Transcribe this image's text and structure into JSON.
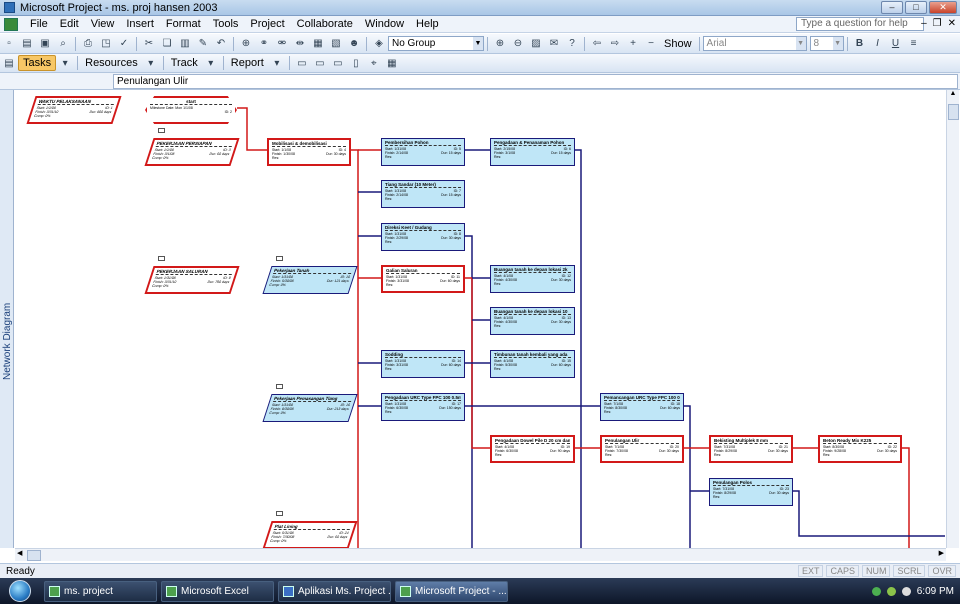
{
  "window": {
    "title": "Microsoft Project - ms. proj hansen 2003"
  },
  "menu": {
    "items": [
      "File",
      "Edit",
      "View",
      "Insert",
      "Format",
      "Tools",
      "Project",
      "Collaborate",
      "Window",
      "Help"
    ],
    "help_placeholder": "Type a question for help"
  },
  "toolbar": {
    "group_value": "No Group",
    "show_label": "Show",
    "font_value": "Arial",
    "size_value": "8"
  },
  "toolbar2": {
    "tasks_label": "Tasks",
    "resources_label": "Resources",
    "track_label": "Track",
    "report_label": "Report"
  },
  "entry": {
    "value": "Penulangan Ulir"
  },
  "viewbar": {
    "label": "Network Diagram"
  },
  "status": {
    "ready": "Ready",
    "indicators": [
      "EXT",
      "CAPS",
      "NUM",
      "SCRL",
      "OVR"
    ]
  },
  "taskbar": {
    "tasks": [
      "ms. project",
      "Microsoft Excel",
      "Aplikasi Ms. Project ...",
      "Microsoft Project - ..."
    ],
    "time": "6:09 PM"
  },
  "nodes": [
    {
      "title": "WAKTU PELAKSANAAN",
      "r1a": "Start: 1/1/08",
      "r1b": "ID: 1",
      "r2a": "Finish: 3/31/10",
      "r2b": "Dur: 800 days",
      "r3": "Comp: 0%"
    },
    {
      "title": "start",
      "r1a": "Milestone Date: Mon 1/1/08",
      "r1b": "",
      "r2a": "",
      "r2b": "ID: 2",
      "r3": ""
    },
    {
      "title": "PEKERJAAN PERSIAPAN",
      "r1a": "Start: 1/1/08",
      "r1b": "ID: 3",
      "r2a": "Finish: 3/1/08",
      "r2b": "Dur: 60 days",
      "r3": "Comp: 0%"
    },
    {
      "title": "Mobilisasi & demobilisasi",
      "r1a": "Start: 1/1/08",
      "r1b": "ID: 4",
      "r2a": "Finish: 1/30/08",
      "r2b": "Dur: 30 days",
      "r3": "Res:"
    },
    {
      "title": "Pembersihan Pohon",
      "r1a": "Start: 1/31/08",
      "r1b": "ID: 5",
      "r2a": "Finish: 2/14/08",
      "r2b": "Dur: 15 days",
      "r3": "Res:"
    },
    {
      "title": "Pengadaan & Penanaman Pohon",
      "r1a": "Start: 2/15/08",
      "r1b": "ID: 6",
      "r2a": "Finish: 3/1/08",
      "r2b": "Dur: 15 days",
      "r3": "Res:"
    },
    {
      "title": "Tiang Sandar (10 Meter)",
      "r1a": "Start: 1/31/08",
      "r1b": "ID: 7",
      "r2a": "Finish: 2/14/08",
      "r2b": "Dur: 15 days",
      "r3": "Res:"
    },
    {
      "title": "Direksi Keet / Gudang",
      "r1a": "Start: 1/31/08",
      "r1b": "ID: 8",
      "r2a": "Finish: 2/29/08",
      "r2b": "Dur: 30 days",
      "r3": "Res:"
    },
    {
      "title": "PEKERJAAN SALURAN",
      "r1a": "Start: 1/31/08",
      "r1b": "ID: 9",
      "r2a": "Finish: 3/31/10",
      "r2b": "Dur: 790 days",
      "r3": "Comp: 0%"
    },
    {
      "title": "Pekerjaan Tanah",
      "r1a": "Start: 1/31/08",
      "r1b": "ID: 10",
      "r2a": "Finish: 5/30/08",
      "r2b": "Dur: 121 days",
      "r3": "Comp: 0%"
    },
    {
      "title": "Galian Saluran",
      "r1a": "Start: 1/31/08",
      "r1b": "ID: 11",
      "r2a": "Finish: 3/31/08",
      "r2b": "Dur: 60 days",
      "r3": "Res:"
    },
    {
      "title": "Buangan tanah ke depan lokasi 2k",
      "r1a": "Start: 4/1/08",
      "r1b": "ID: 12",
      "r2a": "Finish: 4/30/08",
      "r2b": "Dur: 30 days",
      "r3": "Res:"
    },
    {
      "title": "Buangan tanah ke depan lokasi 10",
      "r1a": "Start: 4/1/08",
      "r1b": "ID: 13",
      "r2a": "Finish: 4/30/08",
      "r2b": "Dur: 30 days",
      "r3": "Res:"
    },
    {
      "title": "Sodding",
      "r1a": "Start: 1/31/08",
      "r1b": "ID: 14",
      "r2a": "Finish: 3/31/08",
      "r2b": "Dur: 60 days",
      "r3": "Res:"
    },
    {
      "title": "Timbunan tanah kembali yang ada",
      "r1a": "Start: 4/1/08",
      "r1b": "ID: 15",
      "r2a": "Finish: 5/30/08",
      "r2b": "Dur: 60 days",
      "r3": "Res:"
    },
    {
      "title": "Pekerjaan Pemasangan Tiang",
      "r1a": "Start: 1/31/08",
      "r1b": "ID: 16",
      "r2a": "Finish: 8/30/08",
      "r2b": "Dur: 213 days",
      "r3": "Comp: 0%"
    },
    {
      "title": "Pengadaan URC Type FPC 100 0.5m",
      "r1a": "Start: 1/31/08",
      "r1b": "ID: 17",
      "r2a": "Finish: 6/30/08",
      "r2b": "Dur: 150 days",
      "r3": "Res:"
    },
    {
      "title": "Pemancangan URC Type FPC 100 0.",
      "r1a": "Start: 7/1/08",
      "r1b": "ID: 18",
      "r2a": "Finish: 8/30/08",
      "r2b": "Dur: 60 days",
      "r3": "Res:"
    },
    {
      "title": "Pengadaan Dowel Pile D 20 cm dan",
      "r1a": "Start: 4/1/08",
      "r1b": "ID: 19",
      "r2a": "Finish: 6/30/08",
      "r2b": "Dur: 90 days",
      "r3": "Res:"
    },
    {
      "title": "Penulangan Ulir",
      "r1a": "Start: 7/1/08",
      "r1b": "ID: 20",
      "r2a": "Finish: 7/30/08",
      "r2b": "Dur: 30 days",
      "r3": "Res:"
    },
    {
      "title": "Bekisting Multiplek 8 mm",
      "r1a": "Start: 7/31/08",
      "r1b": "ID: 21",
      "r2a": "Finish: 8/29/08",
      "r2b": "Dur: 30 days",
      "r3": "Res:"
    },
    {
      "title": "Beton Ready Mix K225",
      "r1a": "Start: 8/30/08",
      "r1b": "ID: 22",
      "r2a": "Finish: 9/28/08",
      "r2b": "Dur: 30 days",
      "r3": "Res:"
    },
    {
      "title": "Penulangan Polos",
      "r1a": "Start: 7/31/08",
      "r1b": "ID: 23",
      "r2a": "Finish: 8/29/08",
      "r2b": "Dur: 30 days",
      "r3": "Res:"
    },
    {
      "title": "Plat Lining",
      "r1a": "Start: 5/31/08",
      "r1b": "ID: 24",
      "r2a": "Finish: 7/30/08",
      "r2b": "Dur: 60 days",
      "r3": "Comp: 0%"
    }
  ]
}
